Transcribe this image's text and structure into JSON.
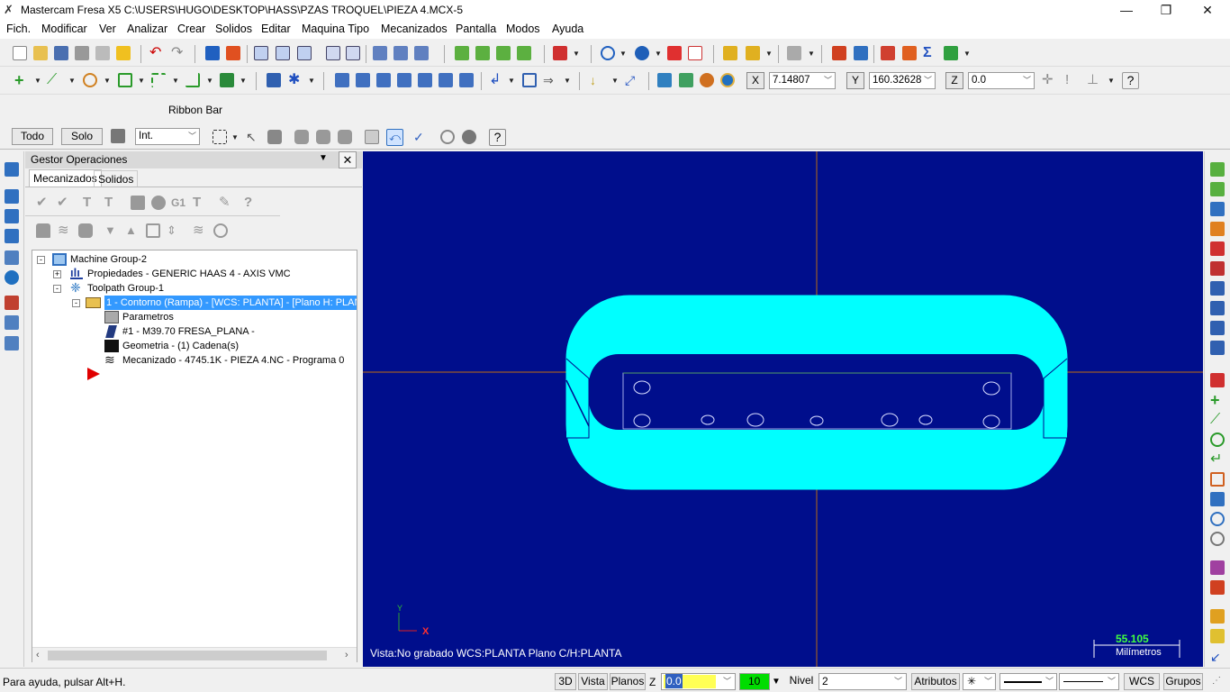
{
  "window": {
    "title": "Mastercam Fresa X5  C:\\USERS\\HUGO\\DESKTOP\\HASS\\PZAS TROQUEL\\PIEZA 4.MCX-5",
    "minimize": "—",
    "maximize": "❐",
    "close": "✕"
  },
  "menu": [
    "Fich.",
    "Modificar",
    "Ver",
    "Analizar",
    "Crear",
    "Solidos",
    "Editar",
    "Maquina Tipo",
    "Mecanizados",
    "Pantalla",
    "Modos",
    "Ayuda"
  ],
  "coords": {
    "x_label": "X",
    "x_value": "7.14807",
    "y_label": "Y",
    "y_value": "160.32628",
    "z_label": "Z",
    "z_value": "0.0"
  },
  "ribbon": {
    "label": "Ribbon Bar"
  },
  "selection_bar": {
    "todo": "Todo",
    "solo": "Solo",
    "mode": "Int."
  },
  "ops_manager": {
    "title": "Gestor Operaciones",
    "tabs": [
      "Mecanizados",
      "Solidos"
    ],
    "tree": [
      "Machine Group-2",
      "Propiedades - GENERIC HAAS 4 - AXIS VMC",
      "Toolpath Group-1",
      "1 - Contorno  (Rampa) - [WCS: PLANTA] - [Plano H: PLANTA]",
      "Parametros",
      "#1 - M39.70 FRESA_PLANA -",
      "Geometria - (1) Cadena(s)",
      "Mecanizado - 4745.1K - PIEZA 4.NC - Programa 0"
    ]
  },
  "viewport": {
    "status": "Vista:No grabado   WCS:PLANTA   Plano C/H:PLANTA",
    "scale_value": "55.105",
    "scale_unit": "Milímetros",
    "axis_x": "X",
    "axis_y": "Y",
    "bg_color": "#000e8c",
    "part_color": "#00ffff"
  },
  "status_bar": {
    "help": "Para ayuda, pulsar Alt+H.",
    "btn_3d": "3D",
    "btn_vista": "Vista",
    "btn_planos": "Planos",
    "z_label": "Z",
    "z_value": "0.0",
    "color_value": "10",
    "nivel_label": "Nivel",
    "nivel_value": "2",
    "atributos": "Atributos",
    "wcs": "WCS",
    "grupos": "Grupos"
  }
}
